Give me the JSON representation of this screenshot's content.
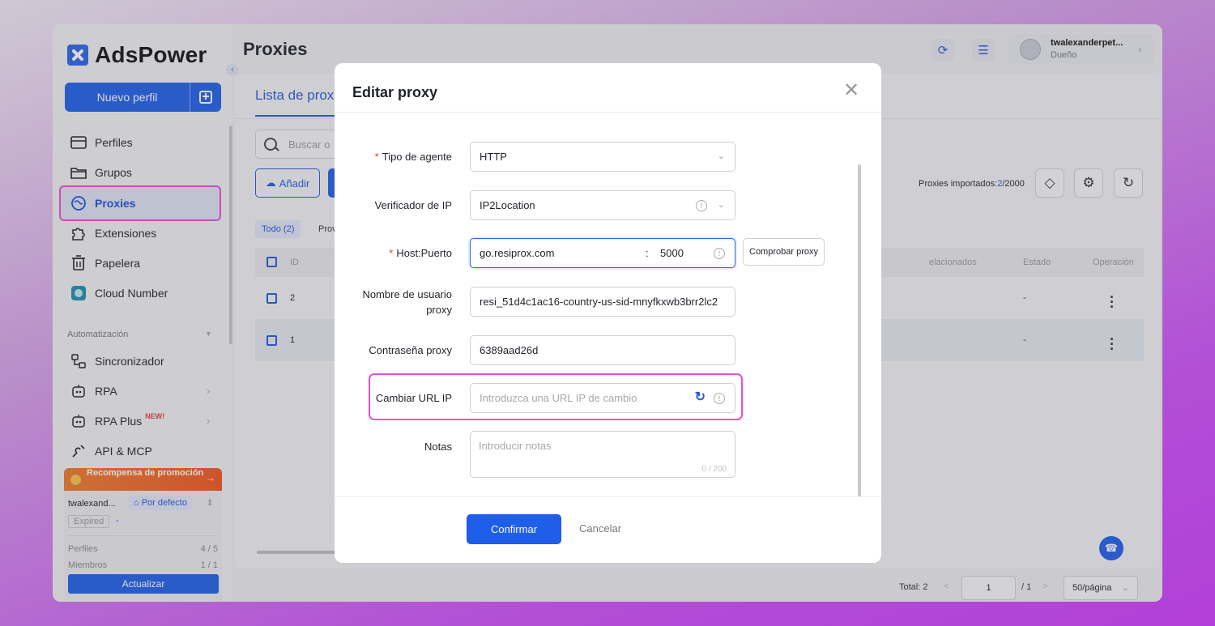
{
  "app": {
    "logo_text": "AdsPower",
    "page_title": "Proxies"
  },
  "sidebar": {
    "new_profile_label": "Nuevo perfil",
    "items": [
      {
        "label": "Perfiles",
        "icon": "profiles-icon"
      },
      {
        "label": "Grupos",
        "icon": "folder-icon"
      },
      {
        "label": "Proxies",
        "icon": "proxy-icon",
        "active": true
      },
      {
        "label": "Extensiones",
        "icon": "puzzle-icon"
      },
      {
        "label": "Papelera",
        "icon": "trash-icon"
      },
      {
        "label": "Cloud Number",
        "icon": "cloud-number-icon"
      }
    ],
    "automation_label": "Automatización",
    "automation_items": [
      {
        "label": "Sincronizador",
        "icon": "sync-icon"
      },
      {
        "label": "RPA",
        "icon": "robot-icon"
      },
      {
        "label": "RPA Plus",
        "icon": "robot-icon",
        "badge": "NEW!"
      },
      {
        "label": "API & MCP",
        "icon": "api-icon"
      }
    ],
    "promo_label": "Recompensa de promoción",
    "account": {
      "name": "twalexand...",
      "default_label": "Por defecto",
      "expired_label": "Expired",
      "expired_value": "-",
      "profiles_label": "Perfiles",
      "profiles_value": "4 / 5",
      "members_label": "Miembros",
      "members_value": "1 / 1",
      "upgrade_label": "Actualizar"
    }
  },
  "header": {
    "user_name": "twalexanderpet...",
    "user_role": "Dueño"
  },
  "main": {
    "tab_label": "Lista de prox",
    "search_placeholder": "Buscar o",
    "add_label": "Añadir",
    "imported_label": "Proxies importados:",
    "imported_current": "2",
    "imported_total": "/2000",
    "filters": {
      "all": "Todo (2)",
      "prov": "Prov"
    },
    "columns": {
      "id": "ID",
      "related": "elacionados",
      "status": "Estado",
      "operation": "Operación"
    },
    "rows": [
      {
        "id": "2",
        "status": "-"
      },
      {
        "id": "1",
        "status": "-"
      }
    ],
    "pagination": {
      "total": "Total: 2",
      "prev": "<",
      "page": "1",
      "of_pages": "/ 1",
      "next": ">",
      "page_size": "50/página"
    }
  },
  "modal": {
    "title": "Editar proxy",
    "fields": {
      "agent_type_label": "Tipo de agente",
      "agent_type_value": "HTTP",
      "ip_checker_label": "Verificador de IP",
      "ip_checker_value": "IP2Location",
      "host_port_label": "Host:Puerto",
      "host_value": "go.resiprox.com",
      "port_separator": ":",
      "port_value": "5000",
      "check_proxy_label": "Comprobar proxy",
      "username_label": "Nombre de usuario proxy",
      "username_value": "resi_51d4c1ac16-country-us-sid-mnyfkxwb3brr2lc2",
      "password_label": "Contraseña proxy",
      "password_value": "6389aad26d",
      "change_url_label": "Cambiar URL IP",
      "change_url_placeholder": "Introduzca una URL IP de cambio",
      "notes_label": "Notas",
      "notes_placeholder": "Introducir notas",
      "notes_counter": "0 / 200"
    },
    "confirm_label": "Confirmar",
    "cancel_label": "Cancelar"
  },
  "colors": {
    "accent": "#1e5ee8",
    "highlight": "#e84fd8",
    "required": "#e53b3b"
  }
}
